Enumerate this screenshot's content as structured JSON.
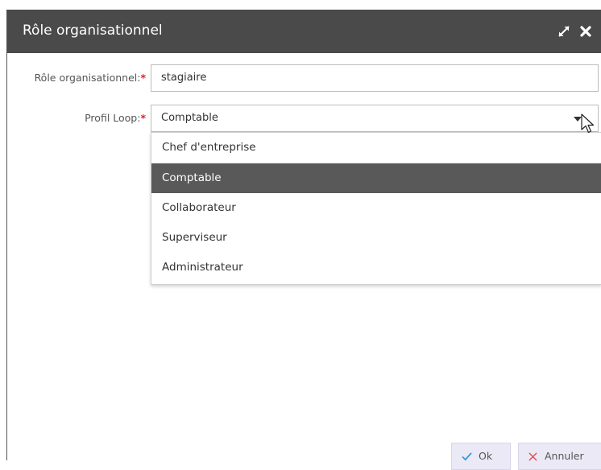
{
  "background": {
    "partial_text": ""
  },
  "dialog": {
    "title": "Rôle organisationnel",
    "maximize_icon": "maximize-arrows-icon",
    "close_icon": "close-x-icon"
  },
  "form": {
    "role": {
      "label": "Rôle organisationnel:",
      "required_mark": "*",
      "value": "stagiaire"
    },
    "profile": {
      "label": "Profil Loop:",
      "required_mark": "*",
      "value": "Comptable",
      "options": [
        "Chef d'entreprise",
        "Comptable",
        "Collaborateur",
        "Superviseur",
        "Administrateur"
      ],
      "selected_index": 1
    }
  },
  "footer": {
    "ok_label": "Ok",
    "cancel_label": "Annuler"
  },
  "colors": {
    "titlebar": "#4a4a4a",
    "selected_option": "#595959",
    "required": "#e02020",
    "ok_check": "#3a9ad9",
    "cancel_x": "#e05050",
    "button_bg": "#ece9f6"
  }
}
